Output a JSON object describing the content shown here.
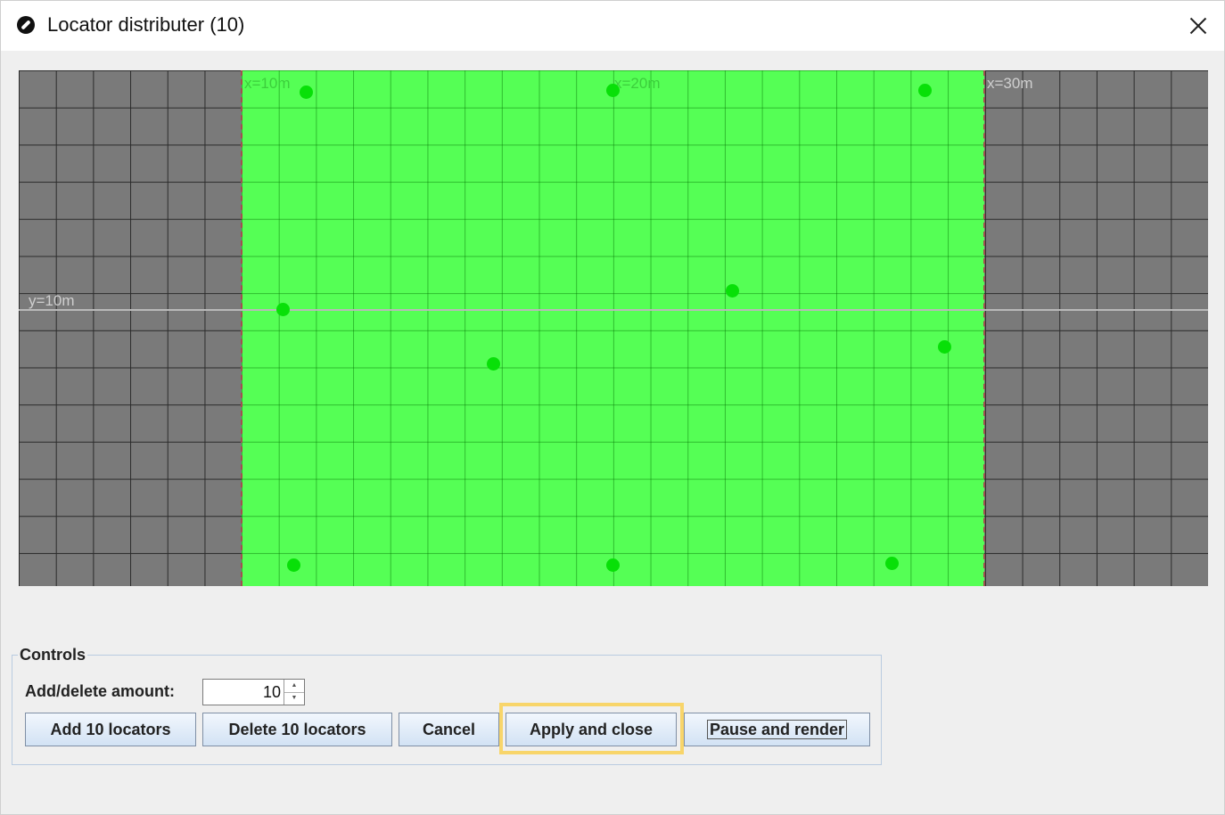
{
  "window": {
    "title": "Locator distributer (10)",
    "close_icon": "close-icon",
    "app_icon": "locator-app-icon"
  },
  "canvas": {
    "x_labels": [
      "x=10m",
      "x=20m",
      "x=30m"
    ],
    "y_labels": [
      "y=10m"
    ],
    "locators_count": 10,
    "colors": {
      "area": "#55ff55",
      "outside": "#7a7a7a",
      "locator": "#08e008"
    }
  },
  "controls": {
    "legend": "Controls",
    "amount_label": "Add/delete amount:",
    "amount_value": "10",
    "buttons": {
      "add": "Add 10 locators",
      "delete": "Delete 10 locators",
      "cancel": "Cancel",
      "apply": "Apply and close",
      "pause": "Pause and render"
    }
  }
}
